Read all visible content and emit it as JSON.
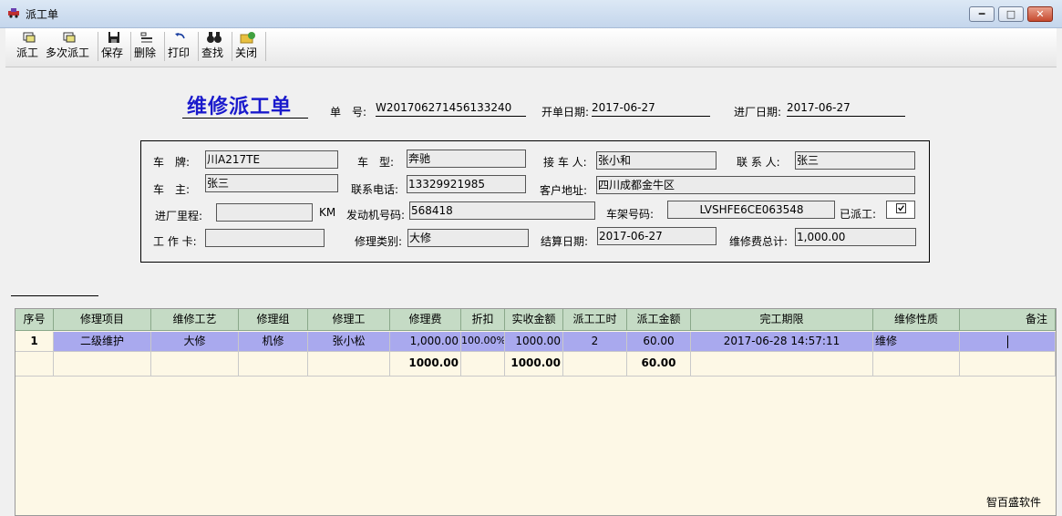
{
  "window": {
    "title": "派工单",
    "min_label": "━",
    "max_label": "□",
    "close_label": "✕"
  },
  "toolbar": {
    "dispatch": "派工",
    "multi_dispatch": "多次派工",
    "save": "保存",
    "delete": "删除",
    "print": "打印",
    "find": "查找",
    "close": "关闭"
  },
  "header": {
    "title": "维修派工单",
    "order_no_label": "单　号:",
    "order_no": "W201706271456133240",
    "open_date_label": "开单日期:",
    "open_date": "2017-06-27",
    "entry_date_label": "进厂日期:",
    "entry_date": "2017-06-27"
  },
  "form": {
    "plate_label": "车　牌:",
    "plate": "川A217TE",
    "model_label": "车　型:",
    "model": "奔驰",
    "receiver_label": "接 车 人:",
    "receiver": "张小和",
    "contact_label": "联 系 人:",
    "contact": "张三",
    "owner_label": "车　主:",
    "owner": "张三",
    "phone_label": "联系电话:",
    "phone": "13329921985",
    "address_label": "客户地址:",
    "address": "四川成都金牛区",
    "mileage_label": "进厂里程:",
    "mileage": "",
    "mileage_unit": "KM",
    "engine_label": "发动机号码:",
    "engine": "568418",
    "vin_label": "车架号码:",
    "vin": "LVSHFE6CE063548",
    "dispatched_label": "已派工:",
    "workcard_label": "工 作 卡:",
    "workcard": "",
    "repair_type_label": "修理类别:",
    "repair_type": "大修",
    "settle_date_label": "结算日期:",
    "settle_date": "2017-06-27",
    "total_fee_label": "维修费总计:",
    "total_fee": "1,000.00"
  },
  "grid": {
    "columns": [
      "序号",
      "修理项目",
      "维修工艺",
      "修理组",
      "修理工",
      "修理费",
      "折扣",
      "实收金额",
      "派工工时",
      "派工金额",
      "完工期限",
      "维修性质",
      "备注"
    ],
    "rows": [
      [
        "1",
        "二级维护",
        "大修",
        "机修",
        "张小松",
        "1,000.00",
        "100.00%",
        "1000.00",
        "2",
        "60.00",
        "2017-06-28 14:57:11",
        "维修",
        ""
      ]
    ],
    "totals": {
      "fee": "1000.00",
      "actual": "1000.00",
      "dispatch_amount": "60.00"
    }
  },
  "footer": {
    "brand": "智百盛软件"
  }
}
